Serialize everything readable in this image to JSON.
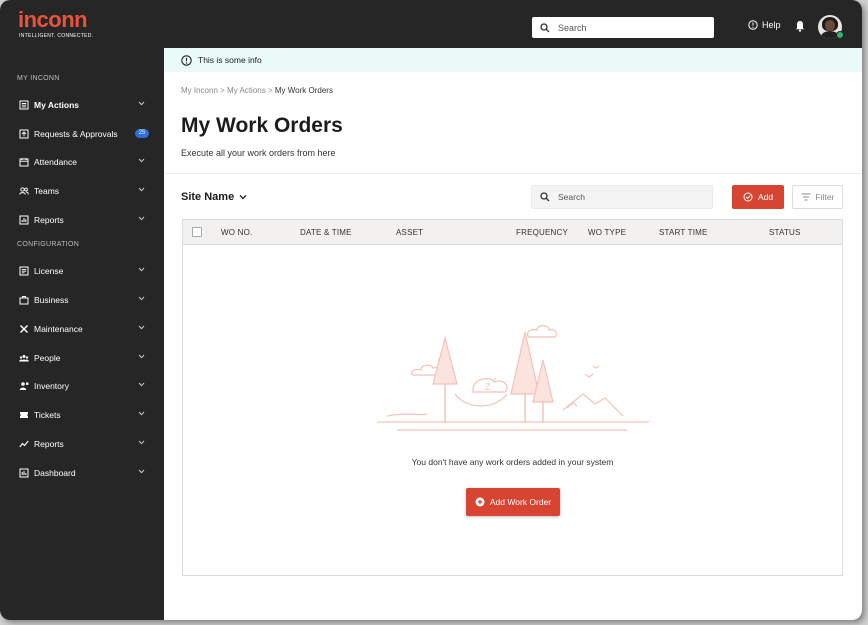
{
  "brand": {
    "logo": "inconn",
    "tagline": "INTELLIGENT. CONNECTED."
  },
  "topbar": {
    "search_placeholder": "Search",
    "help_label": "Help"
  },
  "sidebar": {
    "section_my": "MY INCONN",
    "section_config": "CONFIGURATION",
    "my_items": [
      {
        "label": "My Actions",
        "icon": "list-icon"
      },
      {
        "label": "Requests & Approvals",
        "icon": "inbox-icon",
        "badge": "25"
      },
      {
        "label": "Attendance",
        "icon": "calendar-icon"
      },
      {
        "label": "Teams",
        "icon": "team-icon"
      },
      {
        "label": "Reports",
        "icon": "chart-icon"
      }
    ],
    "config_items": [
      {
        "label": "License",
        "icon": "license-icon"
      },
      {
        "label": "Business",
        "icon": "briefcase-icon"
      },
      {
        "label": "Maintenance",
        "icon": "tools-icon"
      },
      {
        "label": "People",
        "icon": "people-icon"
      },
      {
        "label": "Inventory",
        "icon": "inventory-icon"
      },
      {
        "label": "Tickets",
        "icon": "ticket-icon"
      },
      {
        "label": "Reports",
        "icon": "trend-icon"
      },
      {
        "label": "Dashboard",
        "icon": "dashboard-icon"
      }
    ]
  },
  "info_banner": "This is some info",
  "breadcrumb": {
    "home": "My Inconn",
    "parent": "My Actions",
    "current": "My Work Orders",
    "sep": ">"
  },
  "page": {
    "title": "My Work Orders",
    "subtitle": "Execute all your work orders from here"
  },
  "toolbar": {
    "site_name": "Site Name",
    "search_placeholder": "Search",
    "add_label": "Add",
    "filter_label": "Filter"
  },
  "table": {
    "columns": [
      "WO NO.",
      "DATE & TIME",
      "ASSET",
      "FREQUENCY",
      "WO TYPE",
      "START TIME",
      "STATUS"
    ],
    "rows": []
  },
  "empty_state": {
    "message": "You don't have any work orders added in your system",
    "button_label": "Add Work Order"
  },
  "colors": {
    "accent": "#d84432",
    "sidebar_bg": "#262626",
    "info_bg": "#e9faf7",
    "badge": "#2d6ee0"
  }
}
